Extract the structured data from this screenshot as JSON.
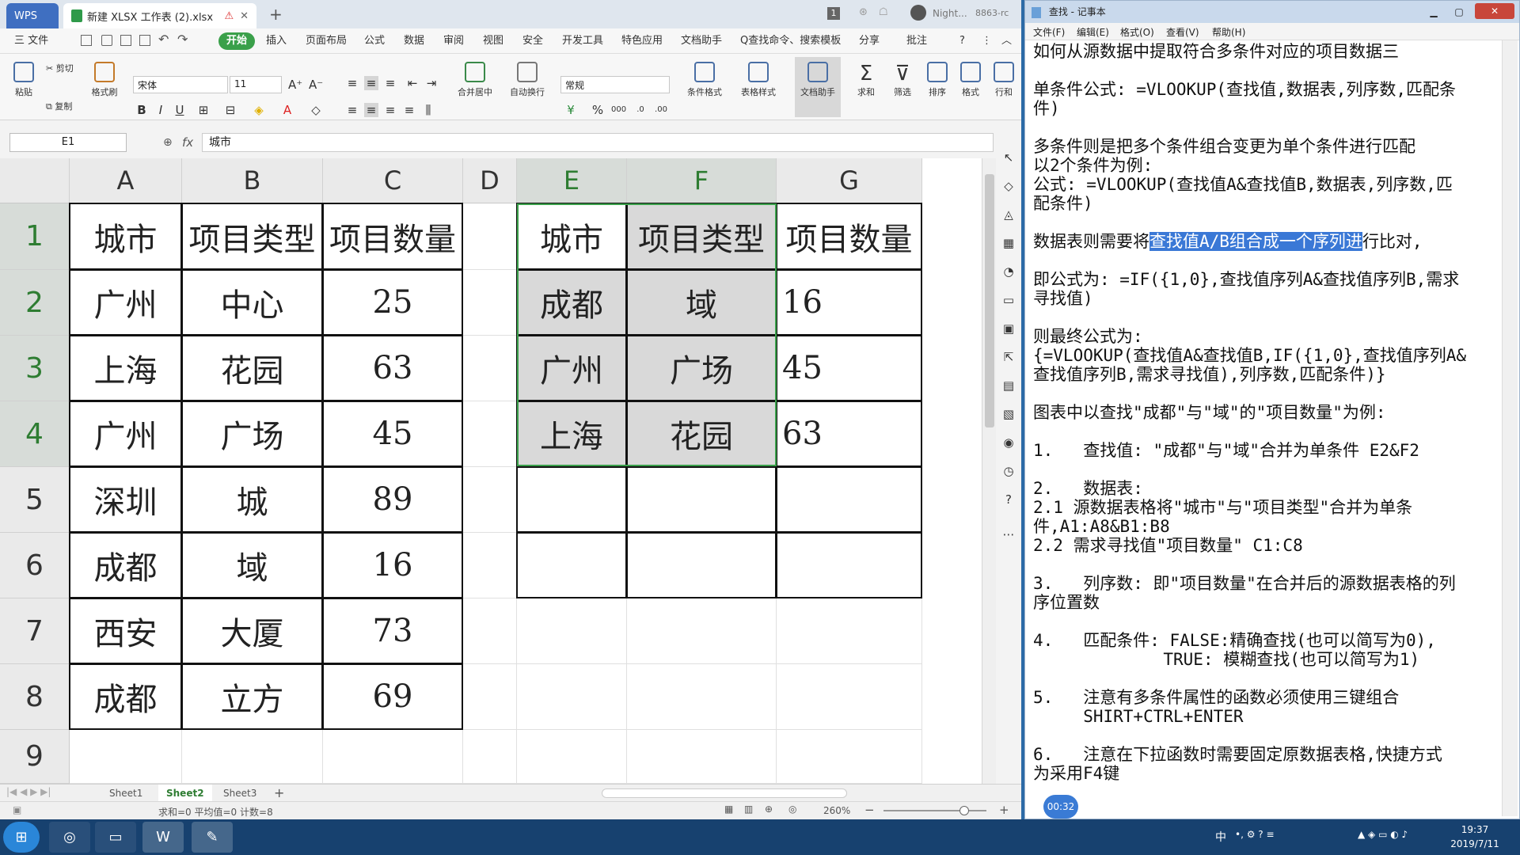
{
  "wps": {
    "app_tab": "WPS",
    "doc_tab": "新建 XLSX 工作表 (2).xlsx",
    "badge": "1",
    "user": "Night...",
    "user_id": "8863-rc",
    "menus": [
      "三 文件",
      "开始",
      "插入",
      "页面布局",
      "公式",
      "数据",
      "审阅",
      "视图",
      "安全",
      "开发工具",
      "特色应用",
      "文档助手",
      "Q查找命令、搜索模板",
      "分享",
      "批注"
    ],
    "ribbon": {
      "paste": "粘贴",
      "cut": "剪切",
      "copy": "复制",
      "format_painter": "格式刷",
      "font": "宋体",
      "font_size": "11",
      "merge": "合并居中",
      "wrap": "自动换行",
      "number_format": "常规",
      "cond_format": "条件格式",
      "table_style": "表格样式",
      "doc_assistant": "文档助手",
      "sum": "求和",
      "filter": "筛选",
      "sort": "排序",
      "format": "格式",
      "rowcol": "行和"
    },
    "name_box": "E1",
    "fx_label": "fx",
    "formula": "城市",
    "columns": [
      "A",
      "B",
      "C",
      "D",
      "E",
      "F",
      "G"
    ],
    "rows": [
      "1",
      "2",
      "3",
      "4",
      "5",
      "6",
      "7",
      "8",
      "9"
    ],
    "table_left": [
      [
        "城市",
        "项目类型",
        "项目数量"
      ],
      [
        "广州",
        "中心",
        "25"
      ],
      [
        "上海",
        "花园",
        "63"
      ],
      [
        "广州",
        "广场",
        "45"
      ],
      [
        "深圳",
        "城",
        "89"
      ],
      [
        "成都",
        "域",
        "16"
      ],
      [
        "西安",
        "大厦",
        "73"
      ],
      [
        "成都",
        "立方",
        "69"
      ]
    ],
    "table_right": [
      [
        "城市",
        "项目类型",
        "项目数量"
      ],
      [
        "成都",
        "域",
        "16"
      ],
      [
        "广州",
        "广场",
        "45"
      ],
      [
        "上海",
        "花园",
        "63"
      ],
      [
        "",
        "",
        ""
      ],
      [
        "",
        "",
        ""
      ]
    ],
    "sheets": [
      "Sheet1",
      "Sheet2",
      "Sheet3"
    ],
    "active_sheet": "Sheet2",
    "status": "求和=0  平均值=0  计数=8",
    "zoom": "260%"
  },
  "notepad": {
    "title": "查找 - 记事本",
    "menus": [
      "文件(F)",
      "编辑(E)",
      "格式(O)",
      "查看(V)",
      "帮助(H)"
    ],
    "lines": [
      "如何从源数据中提取符合多条件对应的项目数据三",
      "",
      "单条件公式: =VLOOKUP(查找值,数据表,列序数,匹配条",
      "件)",
      "",
      "多条件则是把多个条件组合变更为单个条件进行匹配",
      "以2个条件为例:",
      "公式: =VLOOKUP(查找值A&查找值B,数据表,列序数,匹",
      "配条件)",
      "",
      "",
      "",
      "即公式为: =IF({1,0},查找值序列A&查找值序列B,需求",
      "寻找值)",
      "",
      "则最终公式为:",
      "{=VLOOKUP(查找值A&查找值B,IF({1,0},查找值序列A&",
      "查找值序列B,需求寻找值),列序数,匹配条件)}",
      "",
      "图表中以查找\"成都\"与\"域\"的\"项目数量\"为例:",
      "",
      "1.   查找值: \"成都\"与\"域\"合并为单条件 E2&F2",
      "",
      "2.   数据表:",
      "2.1 源数据表格将\"城市\"与\"项目类型\"合并为单条",
      "件,A1:A8&B1:B8",
      "2.2 需求寻找值\"项目数量\" C1:C8",
      "",
      "3.   列序数: 即\"项目数量\"在合并后的源数据表格的列",
      "序位置数",
      "",
      "4.   匹配条件: FALSE:精确查找(也可以简写为0),",
      "             TRUE: 模糊查找(也可以简写为1)",
      "",
      "5.   注意有多条件属性的函数必须使用三键组合",
      "     SHIRT+CTRL+ENTER",
      "",
      "6.   注意在下拉函数时需要固定原数据表格,快捷方式",
      "为采用F4键"
    ],
    "hl_line": {
      "before": "数据表则需要将",
      "highlight": "查找值A/B组合成一个序列进",
      "after": "行比对,"
    }
  },
  "taskbar": {
    "time": "19:37",
    "date": "2019/7/11",
    "ime": "中",
    "timer": "00:32"
  }
}
